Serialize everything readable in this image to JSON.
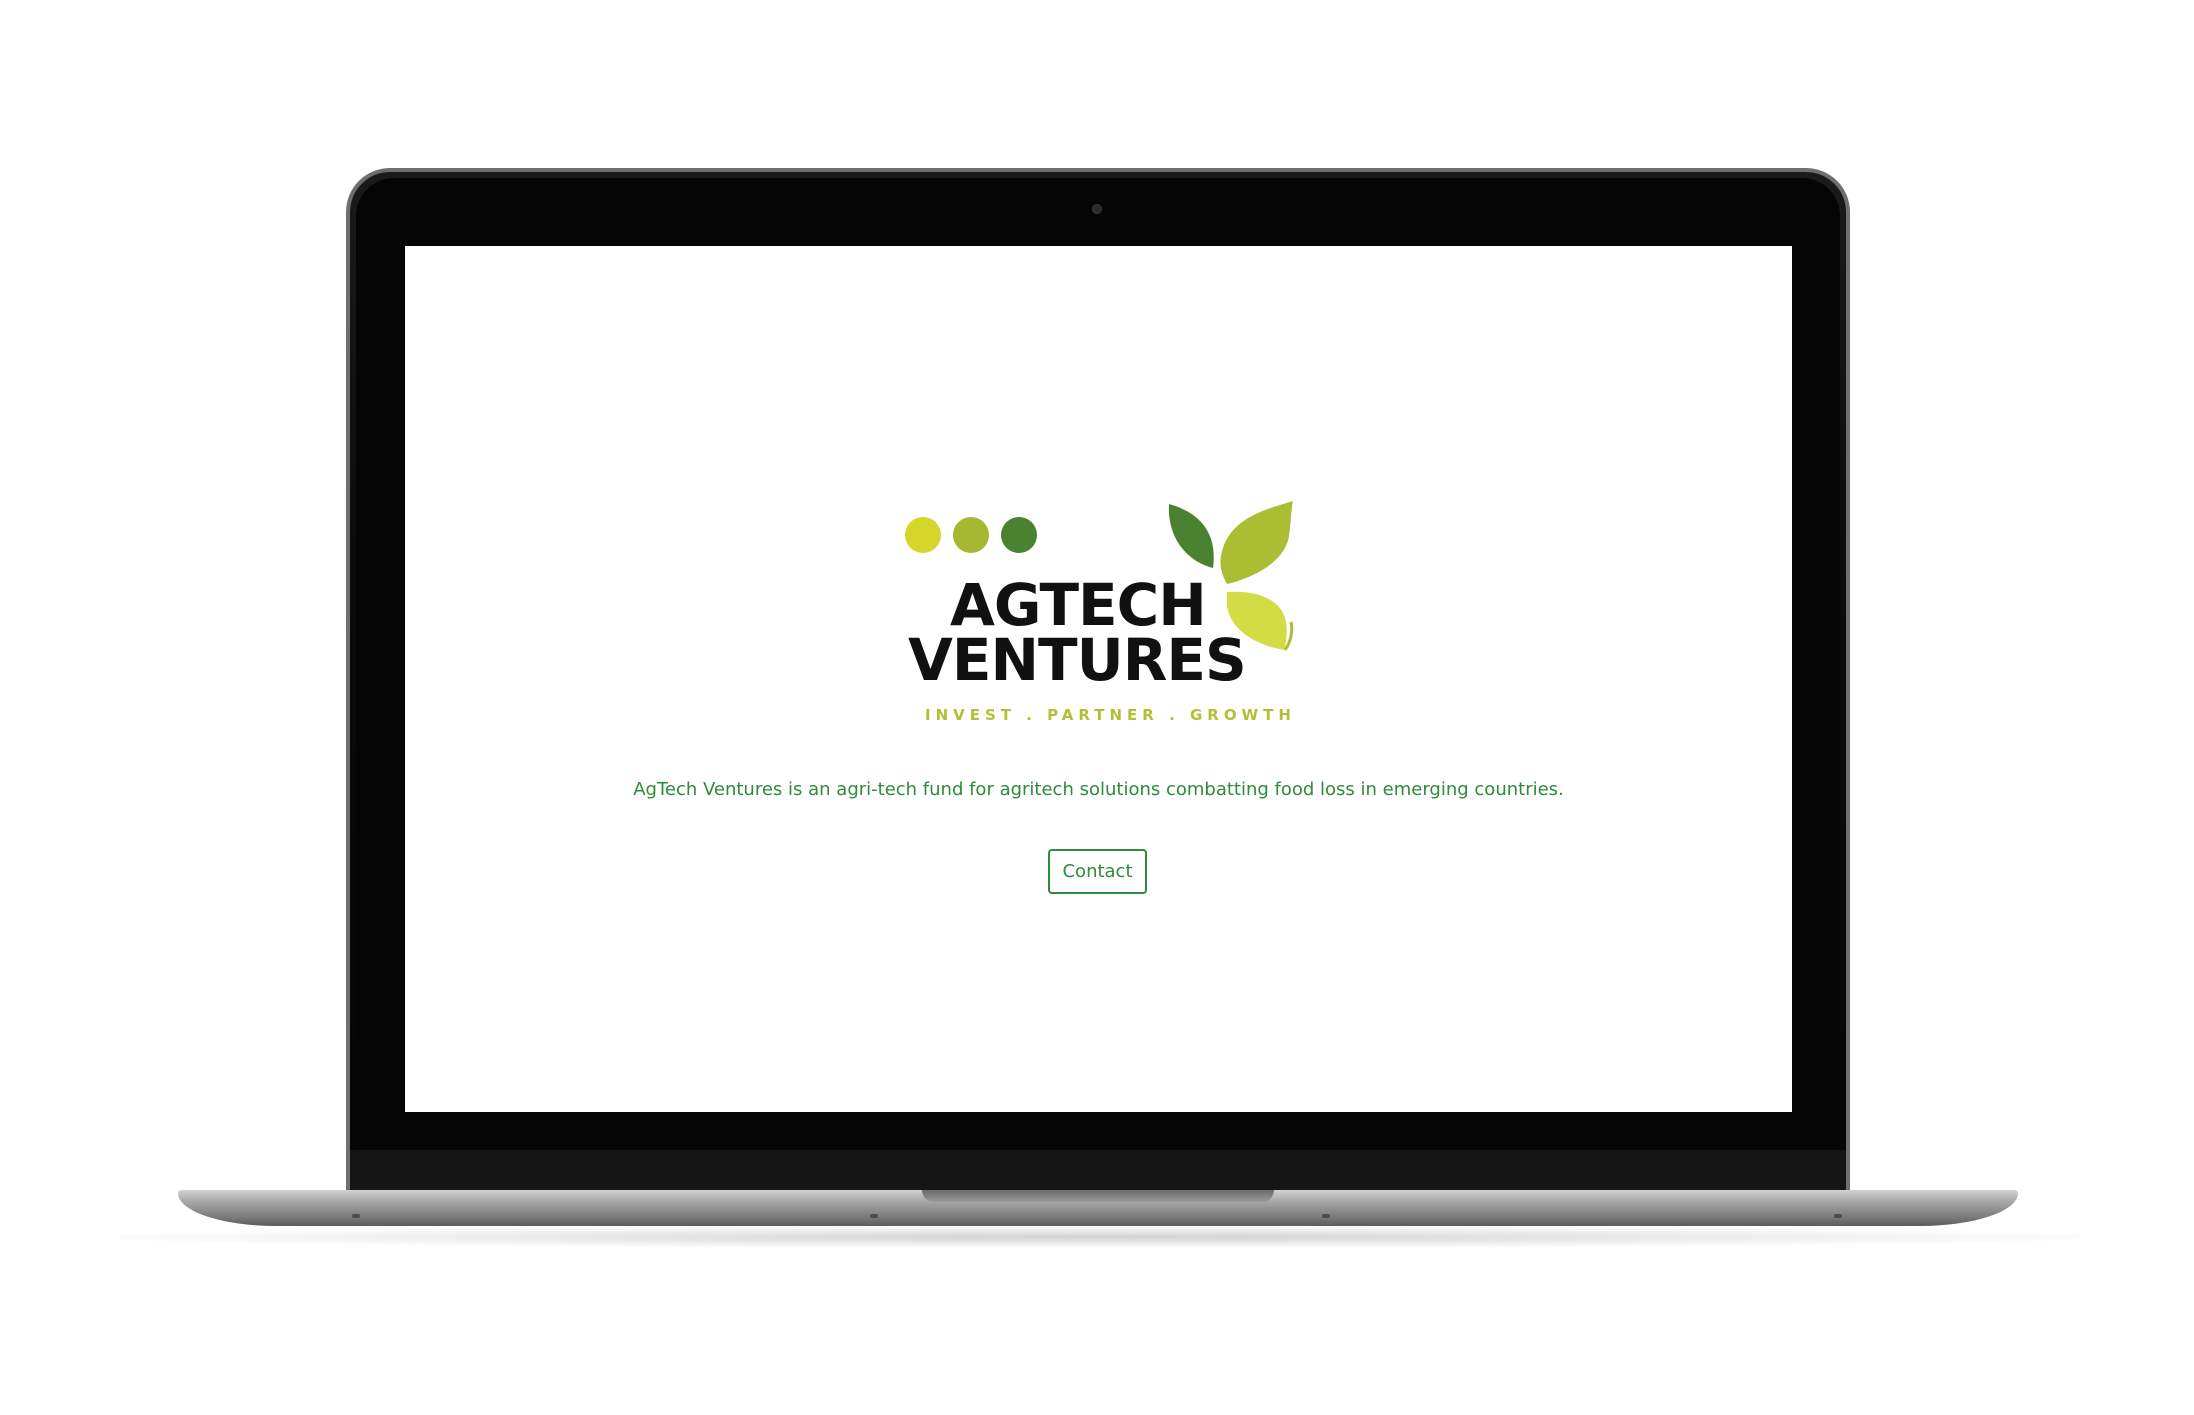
{
  "page": {
    "brand_line1": "AGTECH",
    "brand_line2": "VENTURES",
    "tagline": "INVEST . PARTNER . GROWTH",
    "description": "AgTech Ventures is an agri-tech fund for agritech solutions combatting food loss in emerging countries.",
    "contact_label": "Contact"
  },
  "colors": {
    "accent_green": "#2f8a3b",
    "dot_yellow": "#d5d52a",
    "dot_olive": "#a6b832",
    "dot_dark_green": "#4a8232",
    "leaf_dark": "#4a8232",
    "leaf_mid": "#abbe33",
    "leaf_light": "#d2dd45",
    "tagline_color": "#b2bf33"
  },
  "icons": {
    "logo_dots": "three-circles-icon",
    "logo_leaves": "leaves-icon"
  }
}
